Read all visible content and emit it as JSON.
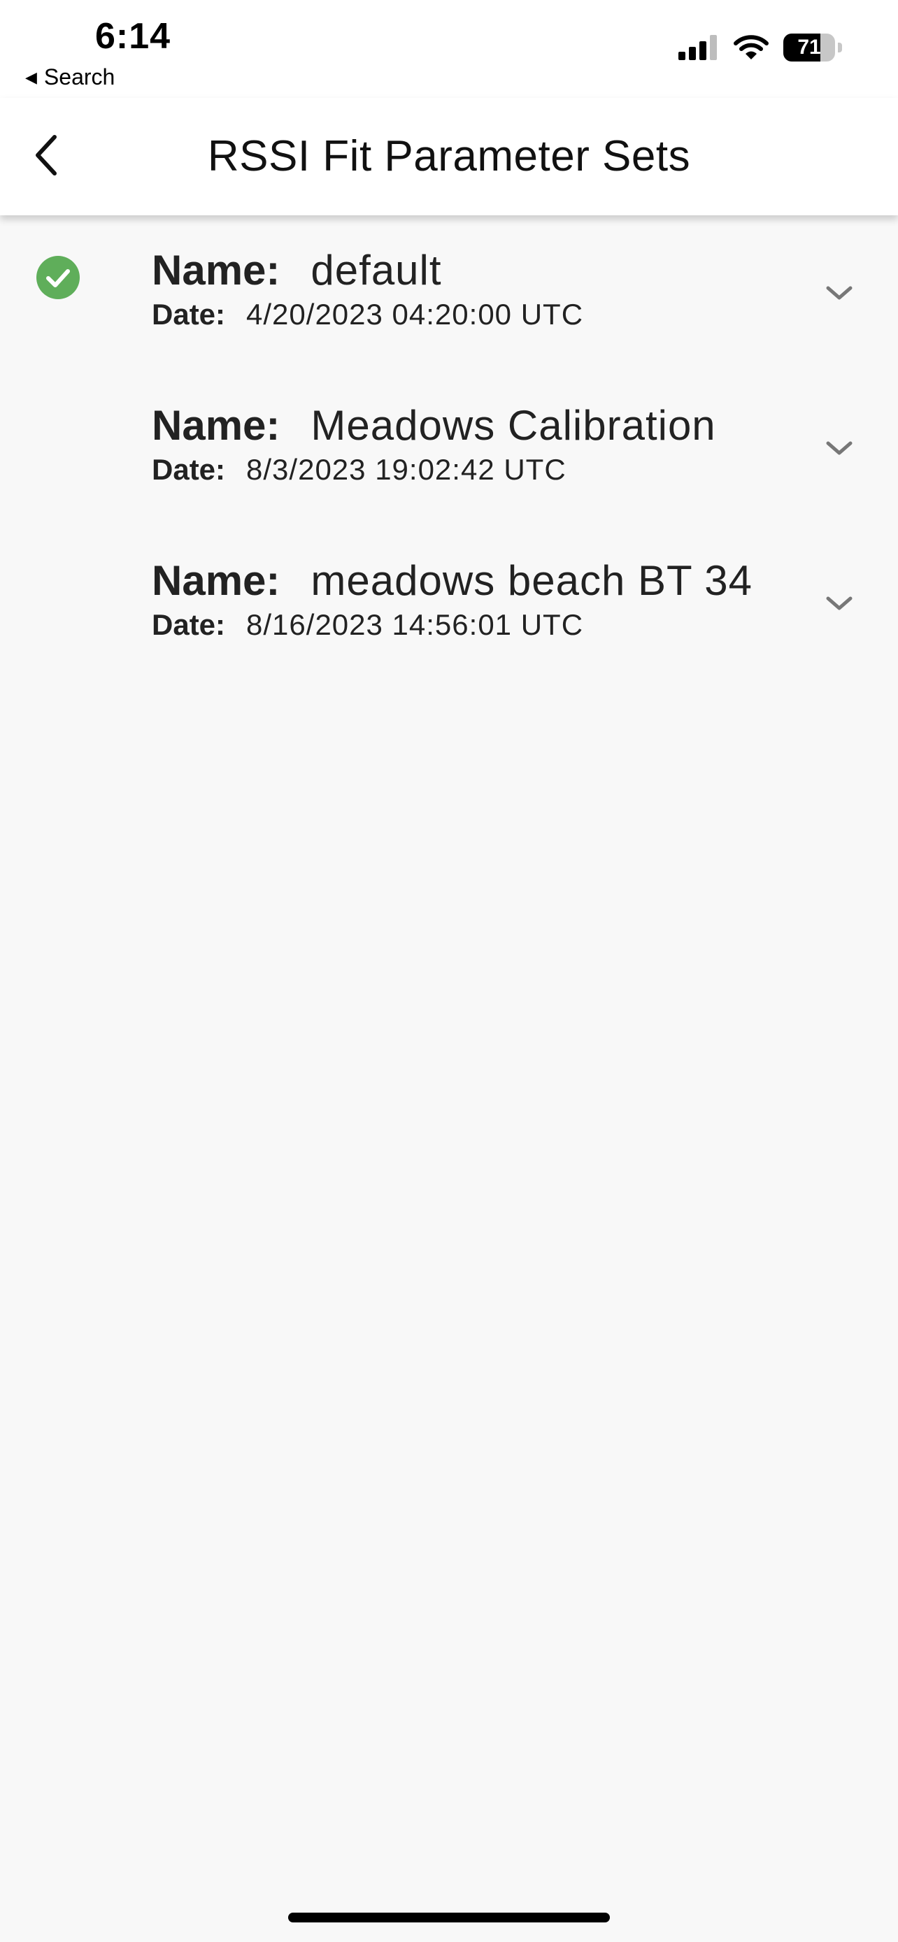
{
  "status_bar": {
    "time": "6:14",
    "back_app": "Search",
    "battery": "71",
    "battery_level_percent": 71
  },
  "header": {
    "title": "RSSI Fit Parameter Sets",
    "back_icon": "chevron-left-icon"
  },
  "labels": {
    "name": "Name:",
    "date": "Date:"
  },
  "items": [
    {
      "name": "default",
      "date": "4/20/2023 04:20:00 UTC",
      "selected": true
    },
    {
      "name": "Meadows Calibration",
      "date": "8/3/2023 19:02:42 UTC",
      "selected": false
    },
    {
      "name": "meadows beach BT 34",
      "date": "8/16/2023 14:56:01 UTC",
      "selected": false
    }
  ],
  "colors": {
    "accent_green": "#5fae5a",
    "background": "#f8f8f8",
    "header_bg": "#ffffff",
    "chevron": "#777777"
  }
}
